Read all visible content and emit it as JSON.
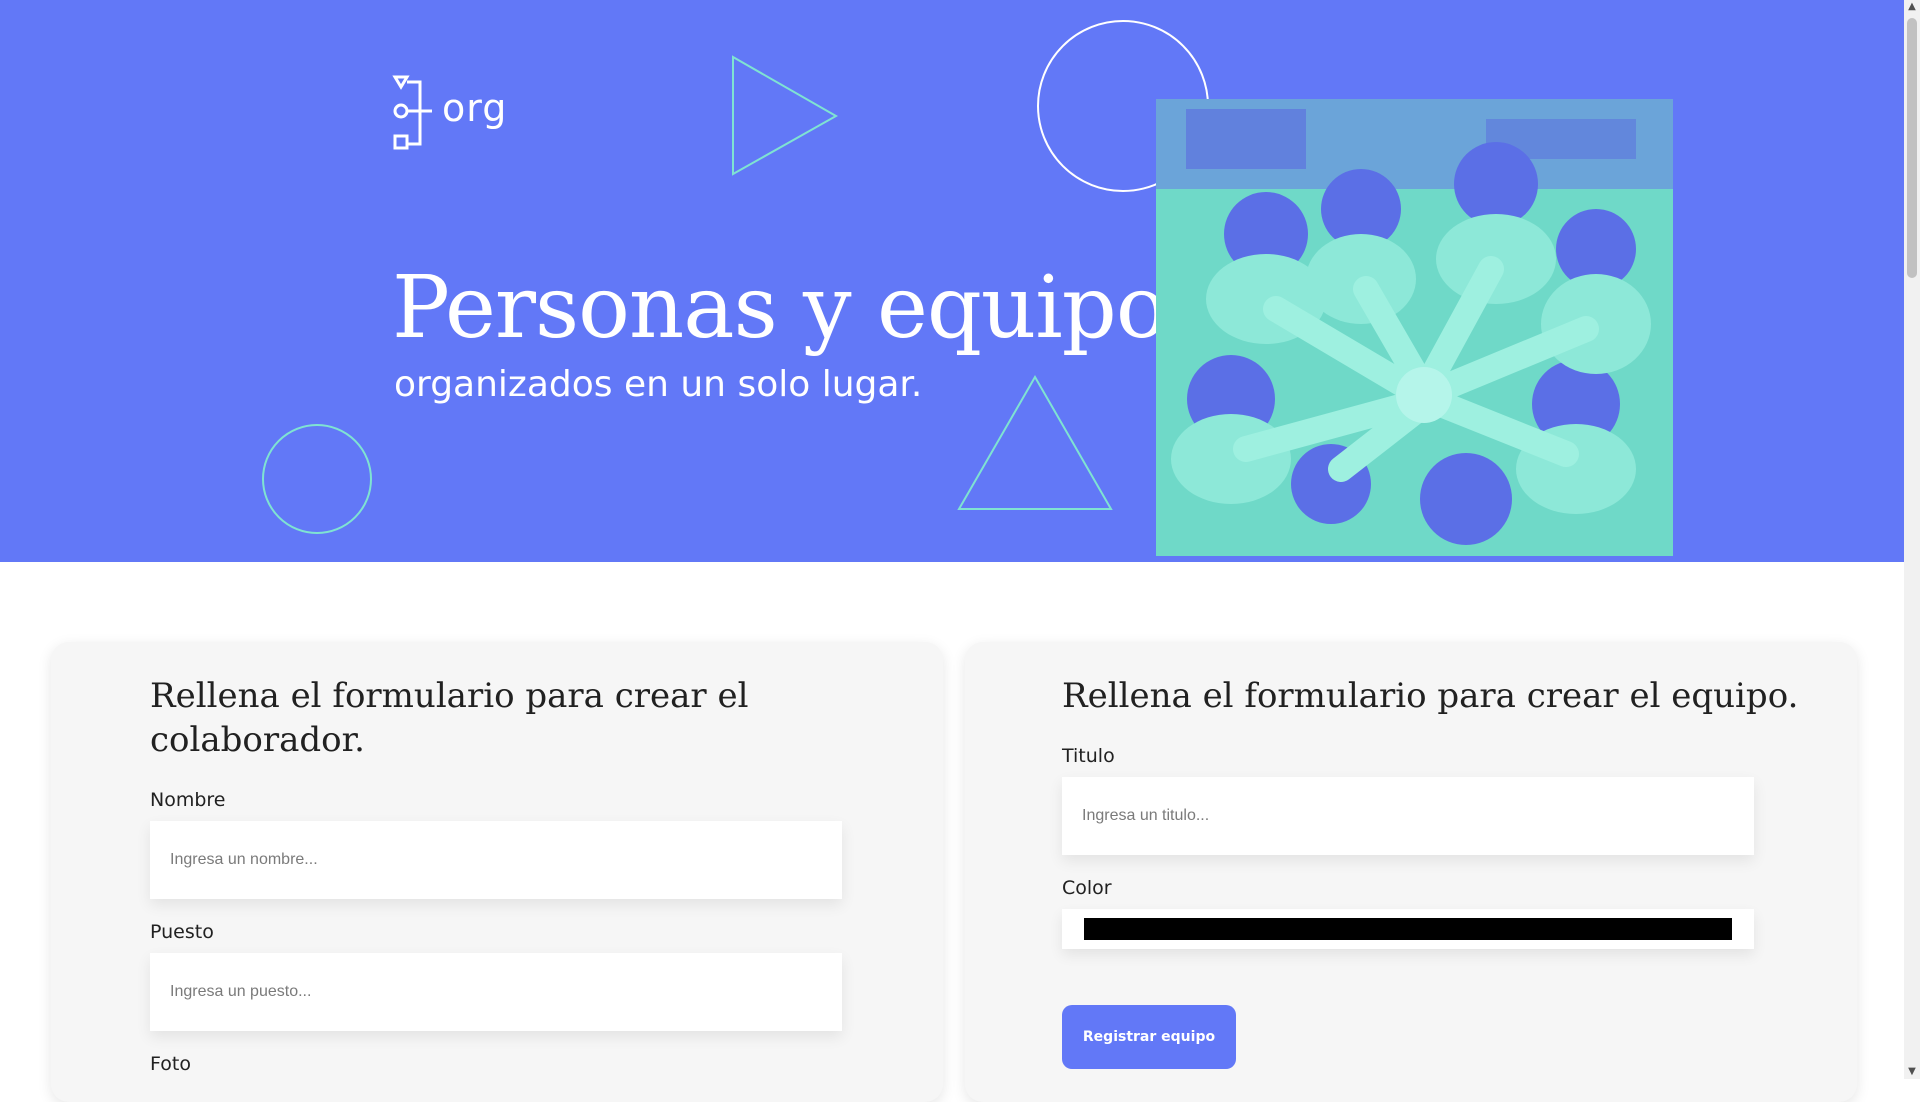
{
  "brand": {
    "logo_text": "org"
  },
  "hero": {
    "title": "Personas y equipos",
    "subtitle": "organizados en un solo lugar.",
    "background_color": "#6278f7",
    "accent_color": "#7fe3d2"
  },
  "collaborator_form": {
    "title": "Rellena el formulario para crear el colaborador.",
    "fields": [
      {
        "label": "Nombre",
        "placeholder": "Ingresa un nombre..."
      },
      {
        "label": "Puesto",
        "placeholder": "Ingresa un puesto..."
      },
      {
        "label": "Foto"
      }
    ]
  },
  "team_form": {
    "title": "Rellena el formulario para crear el equipo.",
    "title_field": {
      "label": "Titulo",
      "placeholder": "Ingresa un titulo..."
    },
    "color_field": {
      "label": "Color",
      "value": "#000000"
    },
    "submit_label": "Registrar equipo"
  },
  "icons": {
    "logo": "org-chart-logo-icon",
    "scroll_up": "scroll-up-arrow-icon",
    "scroll_down": "scroll-down-arrow-icon"
  }
}
